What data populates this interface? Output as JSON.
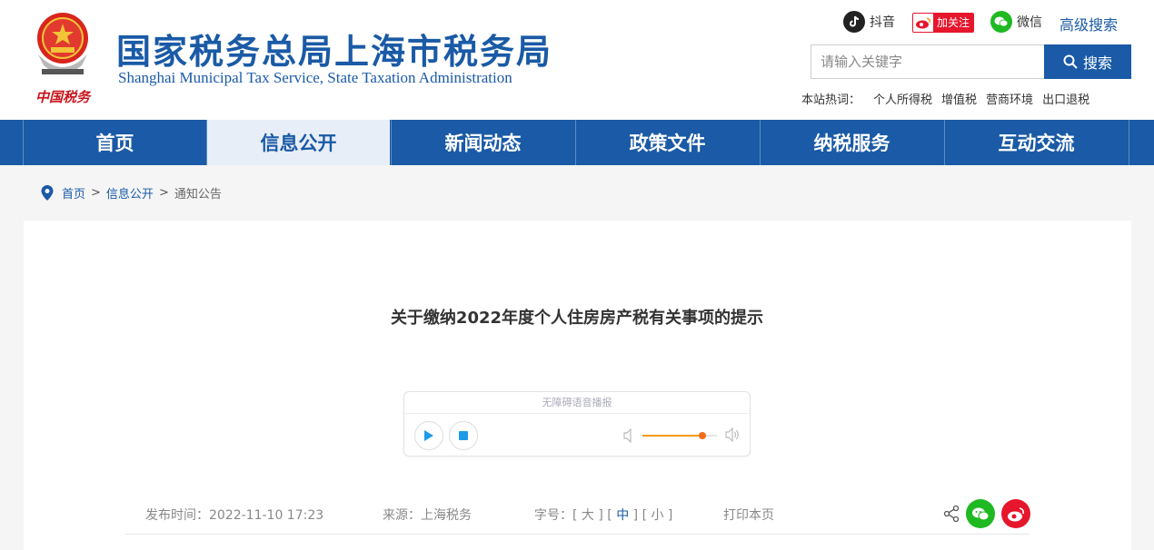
{
  "header": {
    "title": "国家税务总局上海市税务局",
    "subtitle": "Shanghai Municipal Tax Service, State Taxation Administration",
    "logo_text": "中国税务",
    "social": {
      "douyin": "抖音",
      "weibo_follow": "加关注",
      "wechat": "微信"
    },
    "advanced_search": "高级搜索",
    "search": {
      "placeholder": "请输入关键字",
      "button": "搜索"
    },
    "hot": {
      "label": "本站热词：",
      "items": [
        "个人所得税",
        "增值税",
        "营商环境",
        "出口退税"
      ]
    }
  },
  "nav": {
    "items": [
      {
        "label": "首页"
      },
      {
        "label": "信息公开"
      },
      {
        "label": "新闻动态"
      },
      {
        "label": "政策文件"
      },
      {
        "label": "纳税服务"
      },
      {
        "label": "互动交流"
      }
    ],
    "active": "信息公开"
  },
  "breadcrumb": {
    "items": [
      "首页",
      "信息公开",
      "通知公告"
    ],
    "separator": ">"
  },
  "article": {
    "title": "关于缴纳2022年度个人住房房产税有关事项的提示",
    "player": {
      "label": "无障碍语音播报",
      "volume": 0.8
    },
    "meta": {
      "date": "发布时间：2022-11-10 17:23",
      "source": "来源：上海税务",
      "font_size_label": "字号：",
      "sizes": [
        "大",
        "中",
        "小"
      ],
      "active_size": "中",
      "print": "打印本页"
    }
  },
  "colors": {
    "brand_blue": "#1a5aa6",
    "wechat_green": "#1fb922",
    "weibo_red": "#e6162d"
  },
  "icons": [
    "emblem-icon",
    "douyin-icon",
    "weibo-icon",
    "wechat-icon",
    "search-icon",
    "location-pin-icon",
    "play-icon",
    "stop-icon",
    "volume-low-icon",
    "volume-high-icon",
    "share-icon"
  ]
}
